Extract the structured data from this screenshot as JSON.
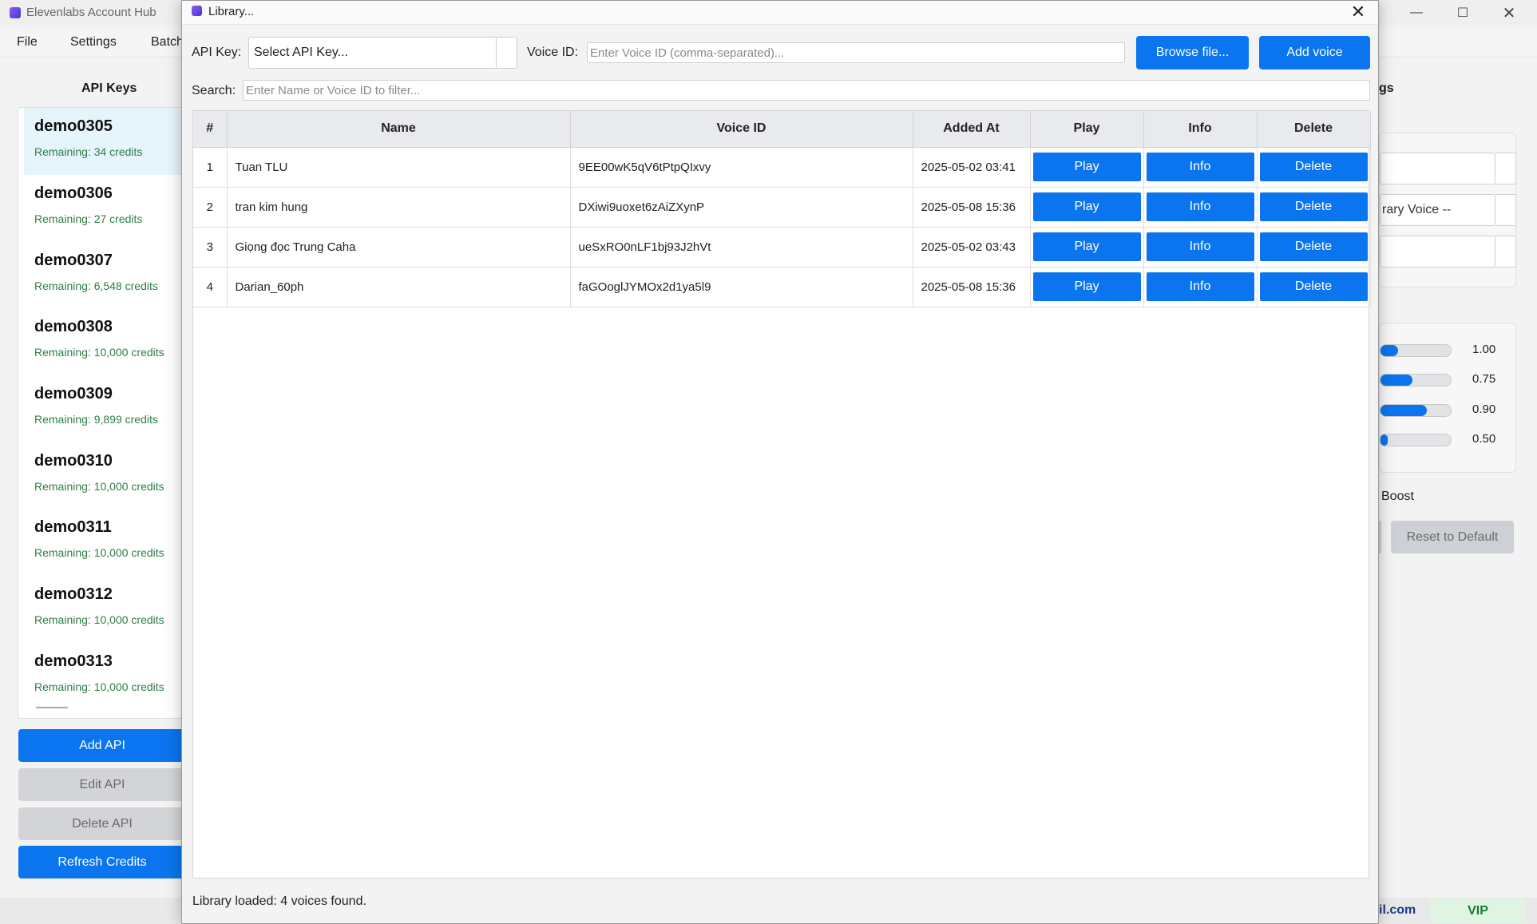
{
  "main": {
    "app_title": "Elevenlabs Account Hub",
    "menu": [
      "File",
      "Settings",
      "Batch"
    ],
    "api_heading": "API Keys",
    "api_keys": [
      {
        "name": "demo0305",
        "remaining": "Remaining: 34 credits"
      },
      {
        "name": "demo0306",
        "remaining": "Remaining: 27 credits"
      },
      {
        "name": "demo0307",
        "remaining": "Remaining: 6,548 credits"
      },
      {
        "name": "demo0308",
        "remaining": "Remaining: 10,000 credits"
      },
      {
        "name": "demo0309",
        "remaining": "Remaining: 9,899 credits"
      },
      {
        "name": "demo0310",
        "remaining": "Remaining: 10,000 credits"
      },
      {
        "name": "demo0311",
        "remaining": "Remaining: 10,000 credits"
      },
      {
        "name": "demo0312",
        "remaining": "Remaining: 10,000 credits"
      },
      {
        "name": "demo0313",
        "remaining": "Remaining: 10,000 credits"
      }
    ],
    "buttons": {
      "add": "Add API",
      "edit": "Edit API",
      "delete": "Delete API",
      "refresh": "Refresh Credits"
    },
    "right_panel": {
      "heading_fragment": "gs",
      "voice_select_fragment": "rary Voice --",
      "sliders": [
        {
          "fill": 0.25,
          "value": "1.00"
        },
        {
          "fill": 0.45,
          "value": "0.75"
        },
        {
          "fill": 0.66,
          "value": "0.90"
        },
        {
          "fill": 0.1,
          "value": "0.50"
        }
      ],
      "boost_label": "Boost",
      "reset_label": "Reset to Default",
      "email_fragment": "il.com",
      "vip_label": "VIP"
    },
    "accent_color": "#0a75ee"
  },
  "dialog": {
    "title": "Library...",
    "api_key_label": "API Key:",
    "api_key_value": "Select API Key...",
    "voice_id_label": "Voice ID:",
    "voice_id_placeholder": "Enter Voice ID (comma-separated)...",
    "browse_label": "Browse file...",
    "add_voice_label": "Add voice",
    "search_label": "Search:",
    "search_placeholder": "Enter Name or Voice ID to filter...",
    "columns": [
      "#",
      "Name",
      "Voice ID",
      "Added At",
      "Play",
      "Info",
      "Delete"
    ],
    "rows": [
      {
        "num": "1",
        "name": "Tuan TLU",
        "voice_id": "9EE00wK5qV6tPtpQIxvy",
        "added_at": "2025-05-02 03:41"
      },
      {
        "num": "2",
        "name": "tran kim hung",
        "voice_id": "DXiwi9uoxet6zAiZXynP",
        "added_at": "2025-05-08 15:36"
      },
      {
        "num": "3",
        "name": "Giọng đọc Trung Caha",
        "voice_id": "ueSxRO0nLF1bj93J2hVt",
        "added_at": "2025-05-02 03:43"
      },
      {
        "num": "4",
        "name": "Darian_60ph",
        "voice_id": "faGOoglJYMOx2d1ya5l9",
        "added_at": "2025-05-08 15:36"
      }
    ],
    "row_buttons": {
      "play": "Play",
      "info": "Info",
      "delete": "Delete"
    },
    "status": "Library loaded: 4 voices found."
  }
}
